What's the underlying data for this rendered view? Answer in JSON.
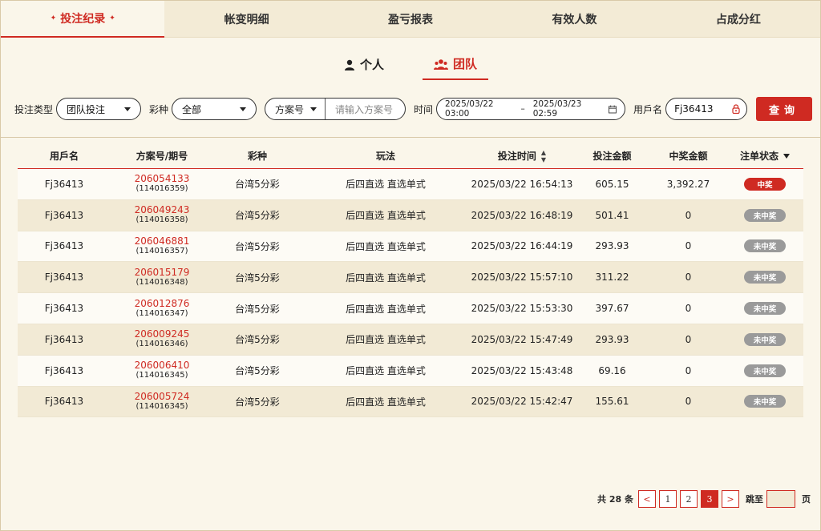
{
  "top_tabs": [
    {
      "label": "投注纪录",
      "active": true
    },
    {
      "label": "帐变明细",
      "active": false
    },
    {
      "label": "盈亏报表",
      "active": false
    },
    {
      "label": "有效人数",
      "active": false
    },
    {
      "label": "占成分红",
      "active": false
    }
  ],
  "sub_tabs": {
    "personal": "个人",
    "team": "团队"
  },
  "filters": {
    "bet_type_label": "投注类型",
    "bet_type_value": "团队投注",
    "lottery_label": "彩种",
    "lottery_value": "全部",
    "scheme_select": "方案号",
    "scheme_placeholder": "请输入方案号",
    "time_label": "时间",
    "time_start": "2025/03/22 03:00",
    "time_sep": "–",
    "time_end": "2025/03/23 02:59",
    "username_label": "用戶名",
    "username_value": "Fj36413",
    "query_button": "查询"
  },
  "table": {
    "headers": [
      "用戶名",
      "方案号/期号",
      "彩种",
      "玩法",
      "投注时间",
      "投注金额",
      "中奖金额",
      "注单状态"
    ],
    "rows": [
      {
        "user": "Fj36413",
        "scheme": "206054133",
        "issue": "(114016359)",
        "lottery": "台湾5分彩",
        "play": "后四直选 直选单式",
        "time": "2025/03/22 16:54:13",
        "amount": "605.15",
        "prize": "3,392.27",
        "status": "中奖",
        "win": true
      },
      {
        "user": "Fj36413",
        "scheme": "206049243",
        "issue": "(114016358)",
        "lottery": "台湾5分彩",
        "play": "后四直选 直选单式",
        "time": "2025/03/22 16:48:19",
        "amount": "501.41",
        "prize": "0",
        "status": "未中奖",
        "win": false
      },
      {
        "user": "Fj36413",
        "scheme": "206046881",
        "issue": "(114016357)",
        "lottery": "台湾5分彩",
        "play": "后四直选 直选单式",
        "time": "2025/03/22 16:44:19",
        "amount": "293.93",
        "prize": "0",
        "status": "未中奖",
        "win": false
      },
      {
        "user": "Fj36413",
        "scheme": "206015179",
        "issue": "(114016348)",
        "lottery": "台湾5分彩",
        "play": "后四直选 直选单式",
        "time": "2025/03/22 15:57:10",
        "amount": "311.22",
        "prize": "0",
        "status": "未中奖",
        "win": false
      },
      {
        "user": "Fj36413",
        "scheme": "206012876",
        "issue": "(114016347)",
        "lottery": "台湾5分彩",
        "play": "后四直选 直选单式",
        "time": "2025/03/22 15:53:30",
        "amount": "397.67",
        "prize": "0",
        "status": "未中奖",
        "win": false
      },
      {
        "user": "Fj36413",
        "scheme": "206009245",
        "issue": "(114016346)",
        "lottery": "台湾5分彩",
        "play": "后四直选 直选单式",
        "time": "2025/03/22 15:47:49",
        "amount": "293.93",
        "prize": "0",
        "status": "未中奖",
        "win": false
      },
      {
        "user": "Fj36413",
        "scheme": "206006410",
        "issue": "(114016345)",
        "lottery": "台湾5分彩",
        "play": "后四直选 直选单式",
        "time": "2025/03/22 15:43:48",
        "amount": "69.16",
        "prize": "0",
        "status": "未中奖",
        "win": false
      },
      {
        "user": "Fj36413",
        "scheme": "206005724",
        "issue": "(114016345)",
        "lottery": "台湾5分彩",
        "play": "后四直选 直选单式",
        "time": "2025/03/22 15:42:47",
        "amount": "155.61",
        "prize": "0",
        "status": "未中奖",
        "win": false
      }
    ]
  },
  "pagination": {
    "total": "共 28 条",
    "pages": [
      "1",
      "2",
      "3"
    ],
    "current": "3",
    "prev": "<",
    "next": ">",
    "jump_label": "跳至",
    "page_suffix": "页"
  },
  "colors": {
    "accent": "#cf2a22",
    "background": "#faf6ea",
    "row_alt": "#f2ead5",
    "lose_badge": "#9a9a9a"
  }
}
